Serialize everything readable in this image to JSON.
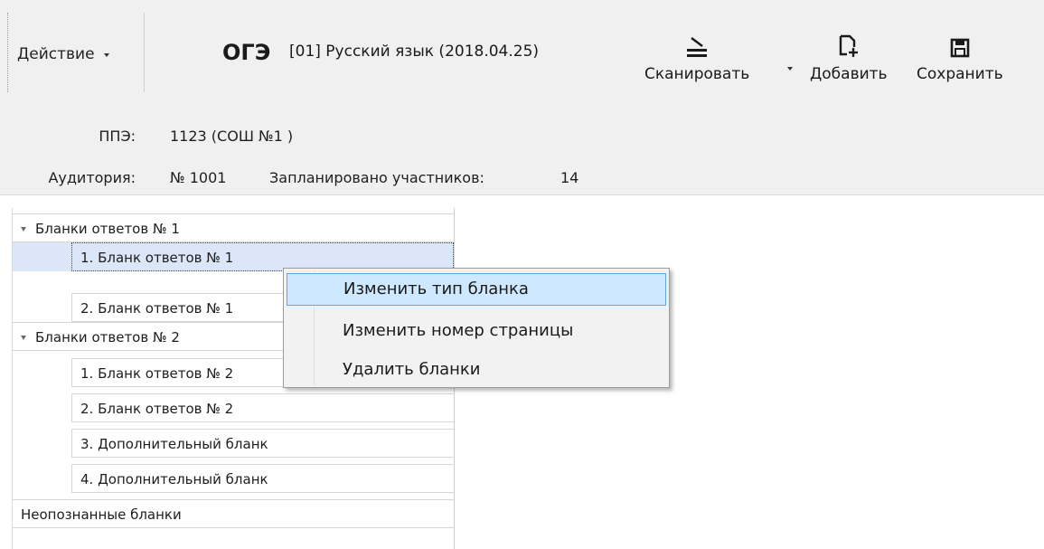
{
  "toolbar": {
    "action_label": "Действие",
    "exam_type": "ОГЭ",
    "exam_subject": "[01] Русский язык (2018.04.25)",
    "scan_label": "Сканировать",
    "add_label": "Добавить",
    "save_label": "Сохранить",
    "icons": {
      "scan": "scanner-icon",
      "add": "add-document-icon",
      "save": "save-icon"
    }
  },
  "info": {
    "ppe_label": "ППЭ:",
    "ppe_value": "1123 (СОШ №1 )",
    "room_label": "Аудитория:",
    "room_value": "№ 1001",
    "planned_label": "Запланировано участников:",
    "planned_value": "14"
  },
  "tree": {
    "groups": [
      {
        "label": "Бланки ответов № 1",
        "items": [
          "1. Бланк ответов № 1",
          "2. Бланк ответов № 1"
        ]
      },
      {
        "label": "Бланки ответов № 2",
        "items": [
          "1. Бланк ответов № 2",
          "2. Бланк ответов № 2",
          "3. Дополнительный бланк",
          "4. Дополнительный бланк"
        ]
      },
      {
        "label": "Неопознанные бланки",
        "items": []
      }
    ]
  },
  "context_menu": {
    "items": [
      "Изменить тип бланка",
      "Изменить номер страницы",
      "Удалить бланки"
    ]
  },
  "colors": {
    "toolbar_bg": "#f0f0f0",
    "selection_bg": "#dbe7f8",
    "menu_highlight": "#cde8ff",
    "menu_highlight_border": "#5aa9e8"
  }
}
